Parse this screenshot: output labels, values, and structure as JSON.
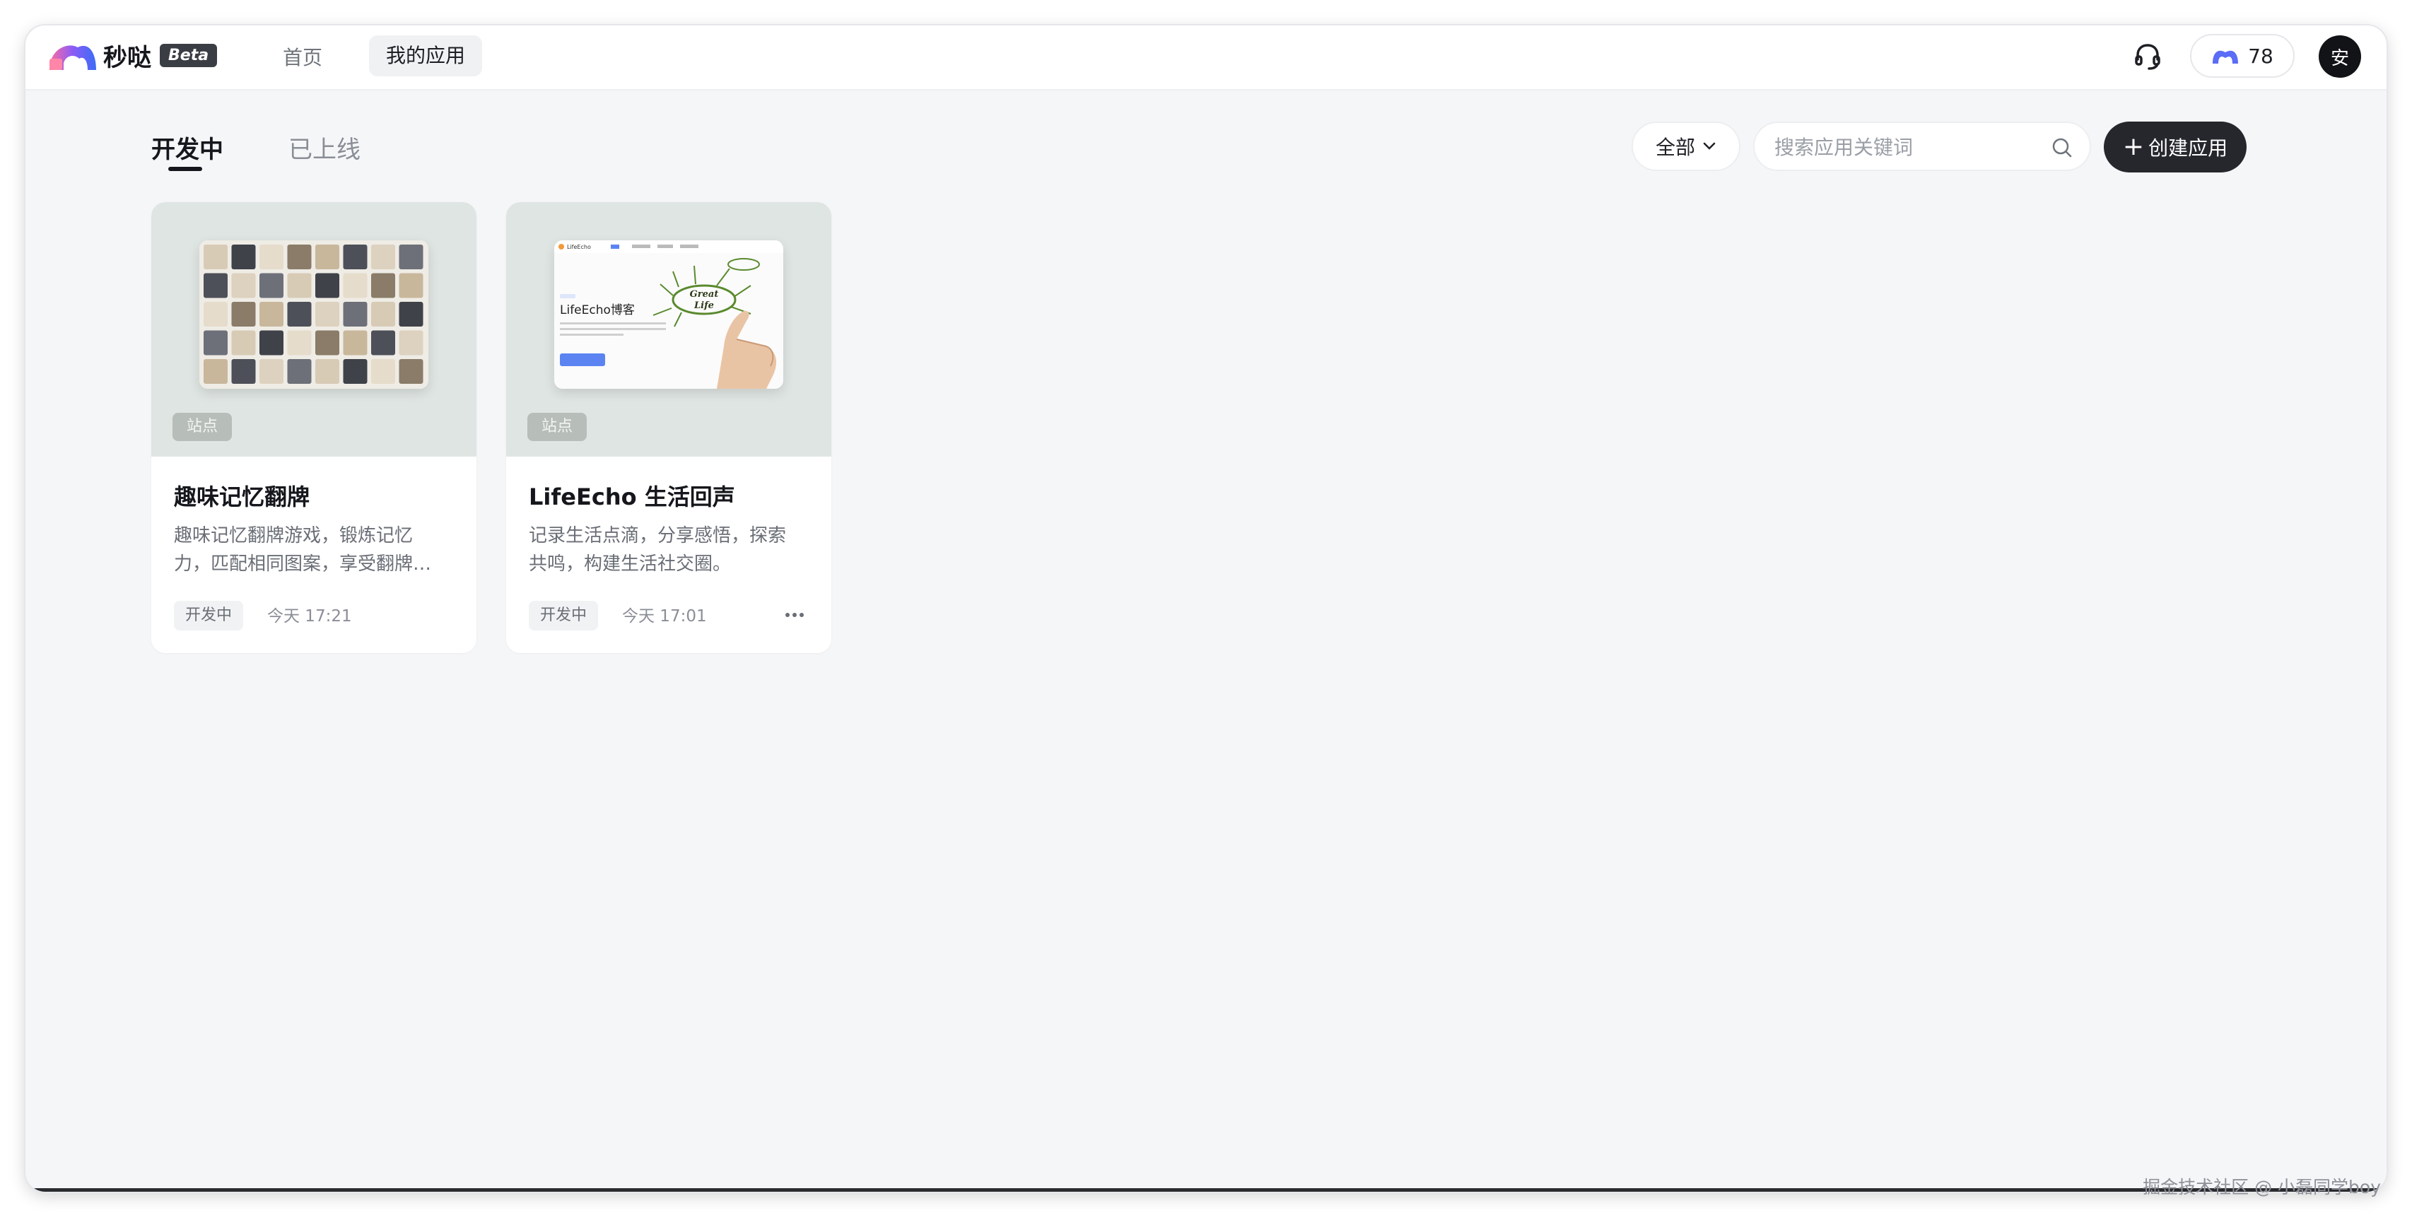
{
  "app": {
    "name": "秒哒",
    "beta": "Beta",
    "nav": {
      "home": "首页",
      "my_apps": "我的应用"
    },
    "credits": "78",
    "avatar": "安"
  },
  "toolbar": {
    "tabs": {
      "developing": "开发中",
      "online": "已上线"
    },
    "filter": "全部",
    "search_placeholder": "搜索应用关键词",
    "create": "创建应用"
  },
  "cards": [
    {
      "badge": "站点",
      "title": "趣味记忆翻牌",
      "desc_line1": "趣味记忆翻牌游戏，锻炼记忆",
      "desc_line2": "力，匹配相同图案，享受翻牌…",
      "status": "开发中",
      "time": "今天 17:21"
    },
    {
      "badge": "站点",
      "title": "LifeEcho 生活回声",
      "desc_line1": "记录生活点滴，分享感悟，探索",
      "desc_line2": "共鸣，构建生活社交圈。",
      "status": "开发中",
      "time": "今天 17:01",
      "preview": {
        "brand": "LifeEcho",
        "heading": "LifeEcho博客",
        "art_line1": "Great",
        "art_line2": "Life"
      }
    }
  ],
  "footer": {
    "watermark": "掘金技术社区 @ 小磊同学boy"
  }
}
